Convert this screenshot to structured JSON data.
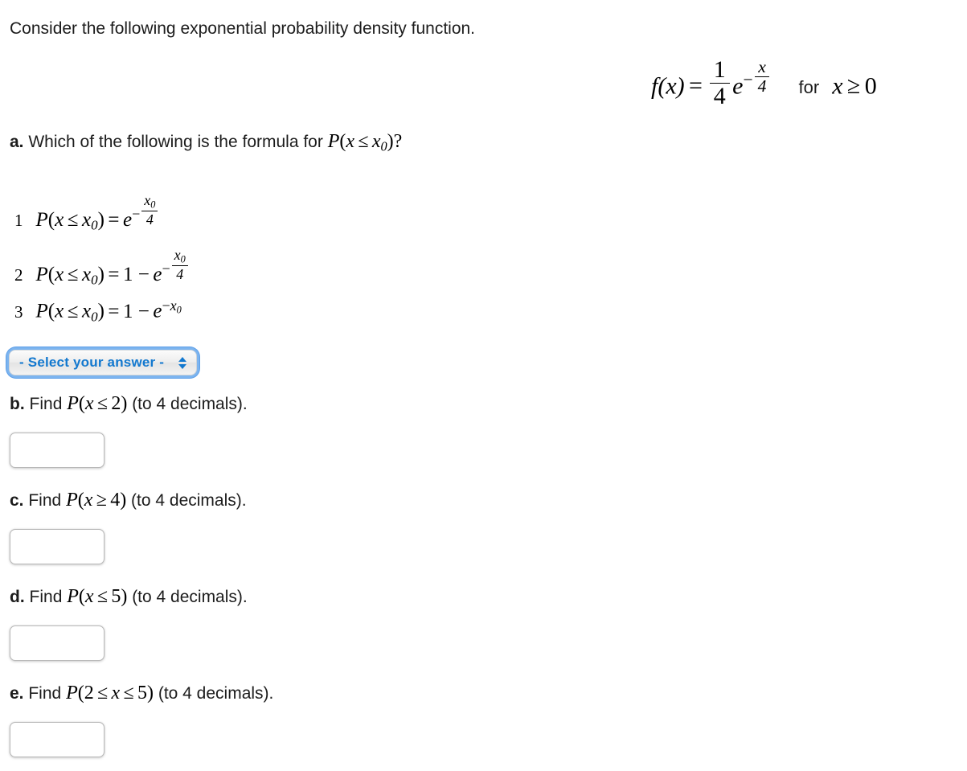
{
  "intro": {
    "text": "Consider the following exponential probability density function."
  },
  "pdf_formula": {
    "lhs": "f(x)",
    "equals": "=",
    "coefficient_numerator": "1",
    "coefficient_denominator": "4",
    "base": "e",
    "exponent_sign": "−",
    "exponent_numerator": "x",
    "exponent_denominator": "4",
    "condition_word": "for",
    "condition_variable": "x",
    "condition_relation": "≥",
    "condition_value": "0"
  },
  "question_a": {
    "label": "a.",
    "text": "Which of the following is the formula for",
    "math_P": "P",
    "math_open": "(",
    "math_var": "x",
    "math_rel": "≤",
    "math_var0": "x",
    "math_sub0": "0",
    "math_close": ")",
    "math_qmark": "?"
  },
  "options": [
    {
      "number": "1",
      "lhs_P": "P",
      "lhs_var": "x",
      "lhs_rel": "≤",
      "lhs_var0": "x",
      "lhs_sub0": "0",
      "equals": "=",
      "prefix": "",
      "base": "e",
      "exp_sign": "−",
      "exp_num": "x",
      "exp_num_sub": "0",
      "exp_den": "4",
      "exp_style": "fraction"
    },
    {
      "number": "2",
      "lhs_P": "P",
      "lhs_var": "x",
      "lhs_rel": "≤",
      "lhs_var0": "x",
      "lhs_sub0": "0",
      "equals": "=",
      "prefix": "1 −",
      "base": "e",
      "exp_sign": "−",
      "exp_num": "x",
      "exp_num_sub": "0",
      "exp_den": "4",
      "exp_style": "fraction"
    },
    {
      "number": "3",
      "lhs_P": "P",
      "lhs_var": "x",
      "lhs_rel": "≤",
      "lhs_var0": "x",
      "lhs_sub0": "0",
      "equals": "=",
      "prefix": "1 −",
      "base": "e",
      "exp_sign": "−",
      "exp_num": "x",
      "exp_num_sub": "0",
      "exp_den": "",
      "exp_style": "plain"
    }
  ],
  "select": {
    "label": "- Select your answer -",
    "value": "- Select your answer -",
    "options": [
      "- Select your answer -",
      "1",
      "2",
      "3"
    ],
    "accent_color": "#1278cf",
    "focus_ring_color": "#7cb4ef"
  },
  "parts": {
    "b": {
      "label": "b.",
      "find_word": "Find",
      "math_P": "P",
      "math_var": "x",
      "math_rel": "≤",
      "math_value": "2",
      "note": "(to 4 decimals).",
      "input_value": "",
      "input_placeholder": ""
    },
    "c": {
      "label": "c.",
      "find_word": "Find",
      "math_P": "P",
      "math_var": "x",
      "math_rel": "≥",
      "math_value": "4",
      "note": "(to 4 decimals).",
      "input_value": "",
      "input_placeholder": ""
    },
    "d": {
      "label": "d.",
      "find_word": "Find",
      "math_P": "P",
      "math_var": "x",
      "math_rel": "≤",
      "math_value": "5",
      "note": "(to 4 decimals).",
      "input_value": "",
      "input_placeholder": ""
    },
    "e": {
      "label": "e.",
      "find_word": "Find",
      "math_P": "P",
      "math_lower": "2",
      "math_rel1": "≤",
      "math_var": "x",
      "math_rel2": "≤",
      "math_value": "5",
      "note": "(to 4 decimals).",
      "input_value": "",
      "input_placeholder": ""
    }
  }
}
